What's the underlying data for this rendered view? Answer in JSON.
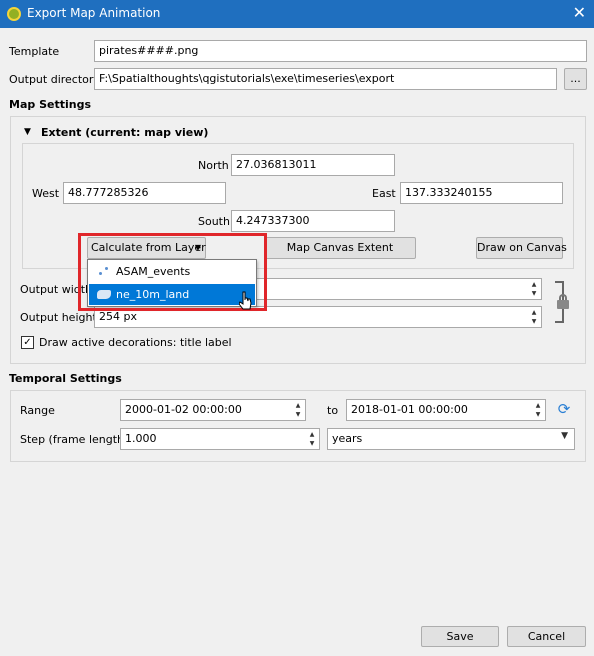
{
  "window": {
    "title": "Export Map Animation",
    "close_glyph": "✕"
  },
  "form": {
    "template_label": "Template",
    "template_value": "pirates####.png",
    "output_dir_label": "Output directory",
    "output_dir_value": "F:\\Spatialthoughts\\qgistutorials\\exe\\timeseries\\export",
    "browse_label": "..."
  },
  "map_settings": {
    "heading": "Map Settings",
    "extent_heading": "Extent (current: map view)",
    "north_label": "North",
    "north_value": "27.036813011",
    "west_label": "West",
    "west_value": "48.777285326",
    "east_label": "East",
    "east_value": "137.333240155",
    "south_label": "South",
    "south_value": "4.247337300",
    "calc_button": "Calculate from Layer",
    "map_canvas_button": "Map Canvas Extent",
    "draw_canvas_button": "Draw on Canvas",
    "layer_menu": [
      {
        "label": "ASAM_events",
        "icon": "point-layer-icon",
        "selected": false
      },
      {
        "label": "ne_10m_land",
        "icon": "polygon-layer-icon",
        "selected": true
      }
    ],
    "output_width_label": "Output width",
    "output_height_label": "Output height",
    "output_height_value": "254 px",
    "decorations_label": "Draw active decorations: title label",
    "decorations_checked": true
  },
  "temporal": {
    "heading": "Temporal Settings",
    "range_label": "Range",
    "range_start": "2000-01-02 00:00:00",
    "to_label": "to",
    "range_end": "2018-01-01 00:00:00",
    "step_label": "Step (frame length)",
    "step_value": "1.000",
    "step_unit": "years"
  },
  "buttons": {
    "save": "Save",
    "cancel": "Cancel"
  }
}
